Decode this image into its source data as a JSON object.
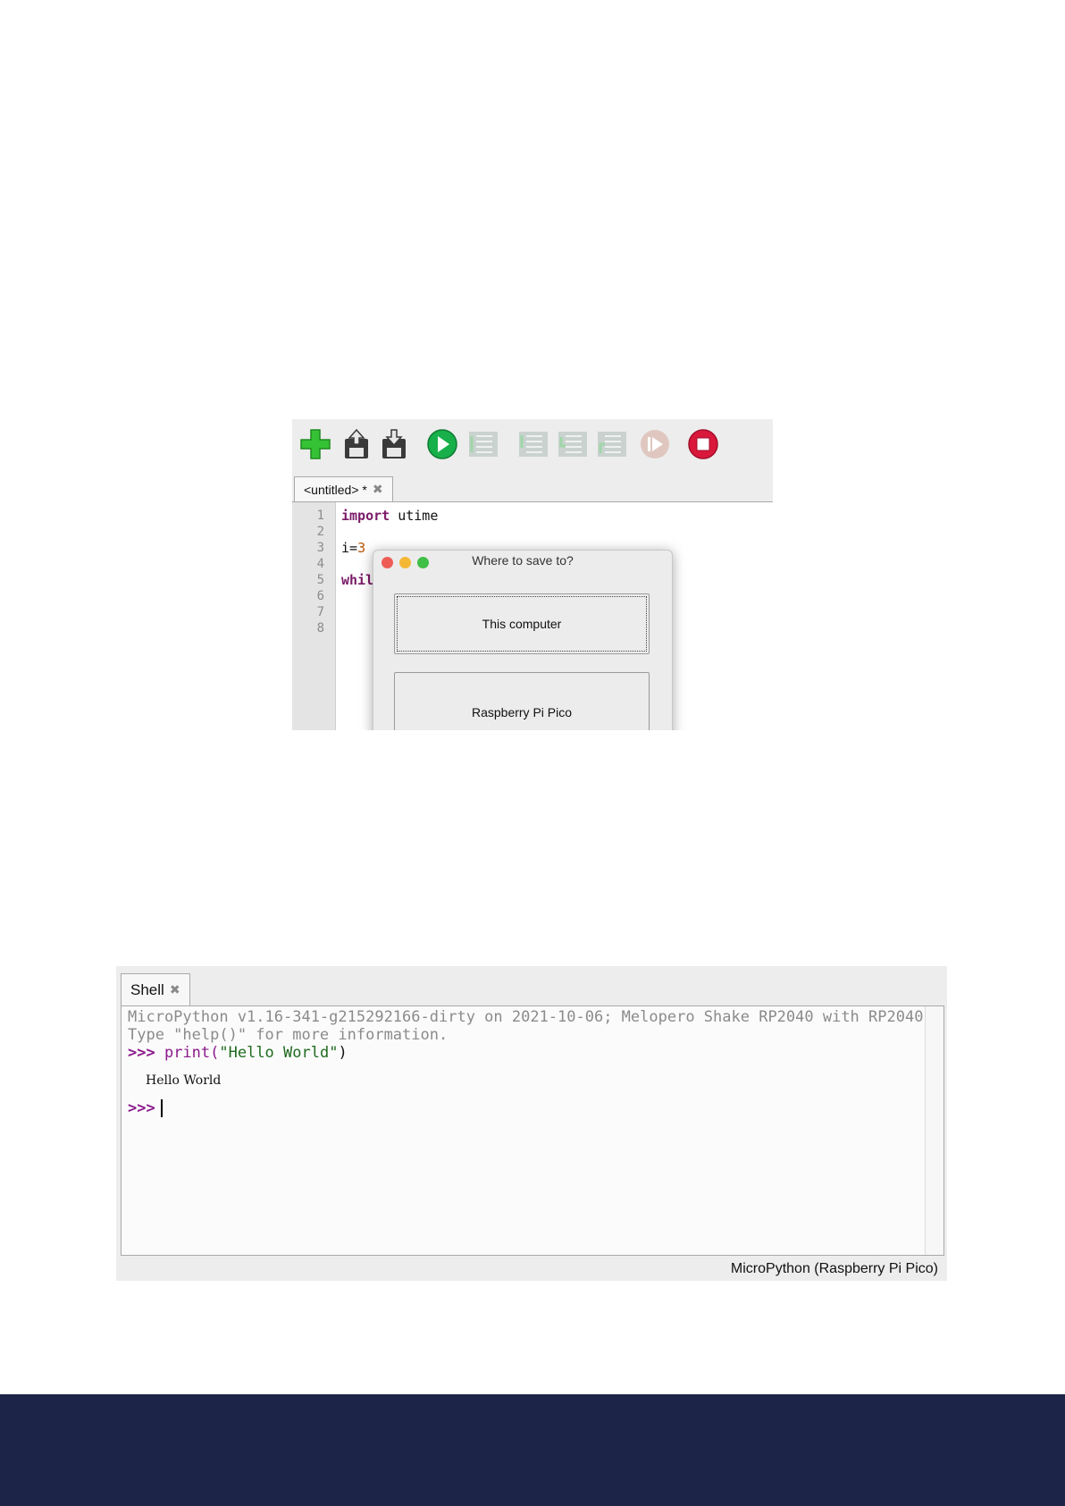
{
  "editor": {
    "toolbar": {
      "icons": [
        "new-file-icon",
        "open-file-icon",
        "save-file-icon",
        "run-icon",
        "debug-icon",
        "step-over-icon",
        "step-into-icon",
        "step-out-icon",
        "resume-icon",
        "stop-icon"
      ],
      "colors": {
        "new": "#35c235",
        "run": "#17b04a",
        "stop": "#d9183b",
        "disabled": "#b9c8c2"
      }
    },
    "tab": {
      "label": "<untitled> *",
      "close": "✖"
    },
    "gutter": [
      "1",
      "2",
      "3",
      "4",
      "5",
      "6",
      "7",
      "8"
    ],
    "code": {
      "l1_kw": "import",
      "l1_rest": " utime",
      "l3_var": "i=",
      "l3_num": "3",
      "l5_kw": "whil"
    },
    "dialog": {
      "title": "Where to save to?",
      "option1": "This computer",
      "option2": "Raspberry Pi Pico"
    }
  },
  "shell": {
    "tab": {
      "label": "Shell",
      "close": "✖"
    },
    "banner1": "MicroPython v1.16-341-g215292166-dirty on 2021-10-06; Melopero Shake RP2040 with RP2040",
    "banner2": "Type \"help()\" for more information.",
    "prompt": ">>>",
    "cmd_fn": " print(",
    "cmd_str": "\"Hello World\"",
    "cmd_end": ")",
    "output": "Hello World",
    "status": "MicroPython (Raspberry Pi Pico)"
  },
  "footer": {
    "color": "#1c2548"
  }
}
